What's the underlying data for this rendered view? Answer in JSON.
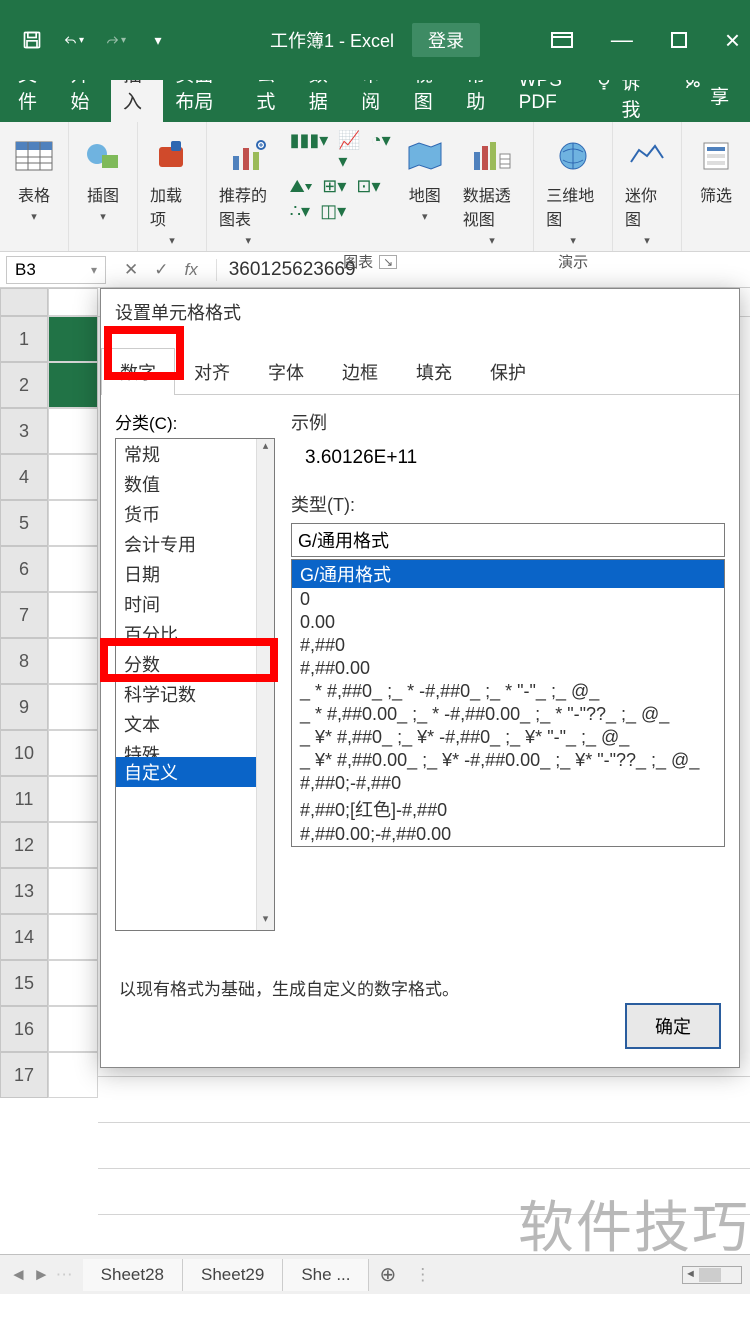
{
  "titlebar": {
    "doc": "工作簿1",
    "app": "Excel",
    "login": "登录"
  },
  "ribbon_tabs": {
    "file": "文件",
    "home": "开始",
    "insert": "插入",
    "layout": "页面布局",
    "formula": "公式",
    "data": "数据",
    "review": "审阅",
    "view": "视图",
    "help": "帮助",
    "wps": "WPS PDF",
    "tellme": "告诉我",
    "share": "共享"
  },
  "ribbon": {
    "tables": "表格",
    "illust": "插图",
    "addins": "加载项",
    "rec_chart": "推荐的图表",
    "maps": "地图",
    "pivot": "数据透视图",
    "map3d": "三维地图",
    "spark": "迷你图",
    "filter": "筛选",
    "grp_charts": "图表",
    "grp_demo": "演示"
  },
  "formula_bar": {
    "cellref": "B3",
    "value": "360125623669"
  },
  "sheet": {
    "tabs": [
      "Sheet28",
      "Sheet29",
      "She  ..."
    ],
    "rows": [
      1,
      2,
      3,
      4,
      5,
      6,
      7,
      8,
      9,
      10,
      11,
      12,
      13,
      14,
      15,
      16,
      17
    ]
  },
  "dialog": {
    "title": "设置单元格格式",
    "tabs": {
      "number": "数字",
      "align": "对齐",
      "font": "字体",
      "border": "边框",
      "fill": "填充",
      "protect": "保护"
    },
    "category_label": "分类(C):",
    "categories": [
      "常规",
      "数值",
      "货币",
      "会计专用",
      "日期",
      "时间",
      "百分比",
      "分数",
      "科学记数",
      "文本",
      "特殊",
      "自定义"
    ],
    "category_selected": "自定义",
    "sample_label": "示例",
    "sample_value": "3.60126E+11",
    "type_label": "类型(T):",
    "type_input": "G/通用格式",
    "type_options": [
      "G/通用格式",
      "0",
      "0.00",
      "#,##0",
      "#,##0.00",
      "_ * #,##0_ ;_ * -#,##0_ ;_ * \"-\"_ ;_ @_",
      "_ * #,##0.00_ ;_ * -#,##0.00_ ;_ * \"-\"??_ ;_ @_",
      "_ ¥* #,##0_ ;_ ¥* -#,##0_ ;_ ¥* \"-\"_ ;_ @_",
      "_ ¥* #,##0.00_ ;_ ¥* -#,##0.00_ ;_ ¥* \"-\"??_ ;_ @_",
      "#,##0;-#,##0",
      "#,##0;[红色]-#,##0",
      "#,##0.00;-#,##0.00"
    ],
    "note": "以现有格式为基础，生成自定义的数字格式。",
    "ok": "确定"
  },
  "watermark": "软件技巧"
}
